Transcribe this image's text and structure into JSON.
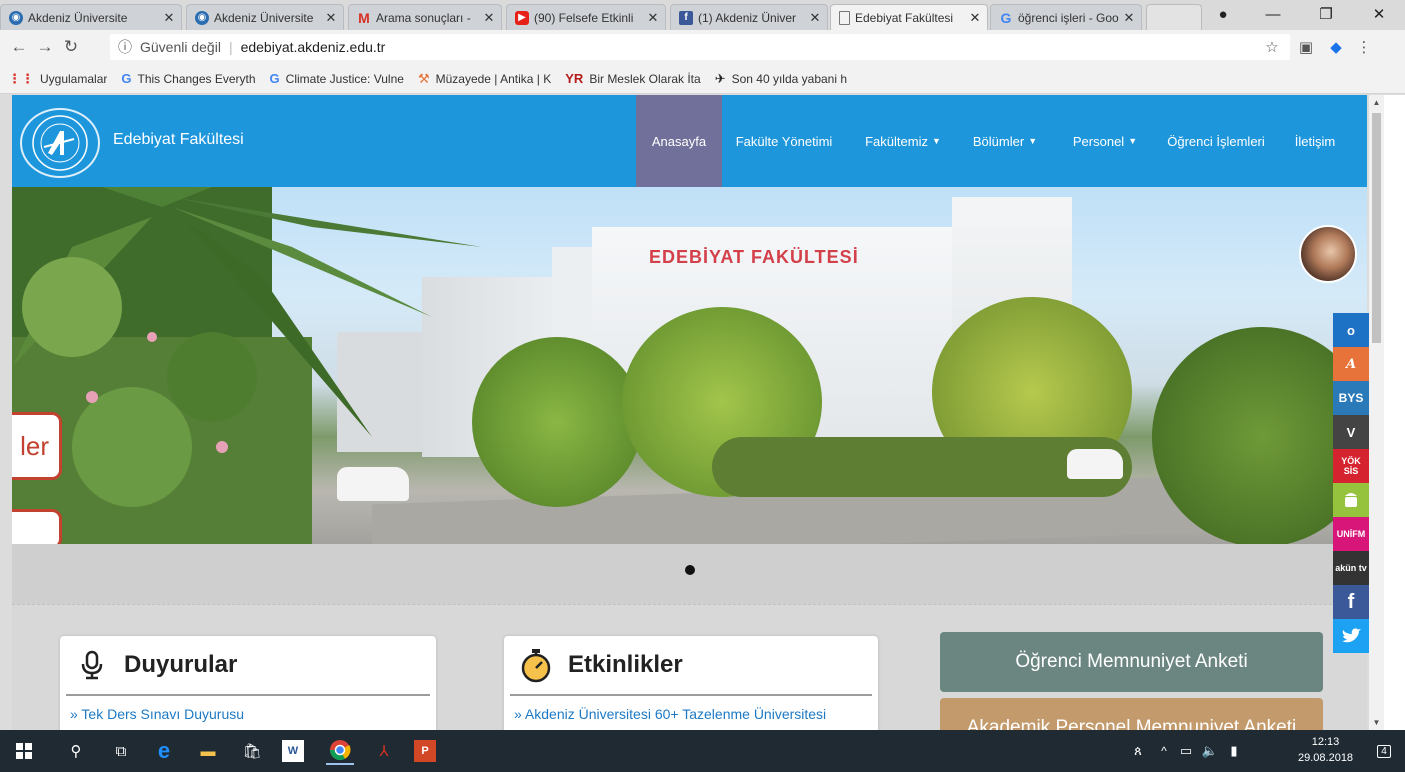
{
  "browser": {
    "tabs": [
      {
        "label": "Akdeniz Üniversite",
        "icon": "akdeniz-logo-icon",
        "color": "#2a6db0"
      },
      {
        "label": "Akdeniz Üniversite",
        "icon": "akdeniz-logo-icon",
        "color": "#2a6db0"
      },
      {
        "label": "Arama sonuçları -",
        "icon": "gmail-icon",
        "color": "#d93025"
      },
      {
        "label": "(90) Felsefe Etkinli",
        "icon": "youtube-icon",
        "color": "#e62117"
      },
      {
        "label": "(1) Akdeniz Üniver",
        "icon": "facebook-icon",
        "color": "#3b5998"
      },
      {
        "label": "Edebiyat Fakültesi",
        "icon": "page-icon",
        "color": "#777777"
      },
      {
        "label": "öğrenci işleri - Goo",
        "icon": "google-icon",
        "color": "#4285f4"
      }
    ],
    "address": {
      "security": "Güvenli değil",
      "url": "edebiyat.akdeniz.edu.tr"
    },
    "bookmarks": [
      {
        "label": "Uygulamalar",
        "icon": "apps-grid-icon"
      },
      {
        "label": "This Changes Everyth",
        "icon": "google-icon"
      },
      {
        "label": "Climate Justice: Vulne",
        "icon": "google-icon"
      },
      {
        "label": "Müzayede | Antika | K",
        "icon": "gavel-icon"
      },
      {
        "label": "Bir Meslek Olarak İta",
        "icon": "yr-icon"
      },
      {
        "label": "Son 40 yılda yabani h",
        "icon": "bird-icon"
      }
    ]
  },
  "site": {
    "name": "Edebiyat Fakültesi",
    "nav": [
      {
        "label": "Anasayfa",
        "dropdown": false
      },
      {
        "label": "Fakülte Yönetimi",
        "dropdown": false
      },
      {
        "label": "Fakültemiz",
        "dropdown": true
      },
      {
        "label": "Bölümler",
        "dropdown": true
      },
      {
        "label": "Personel",
        "dropdown": true
      },
      {
        "label": "Öğrenci İşlemleri",
        "dropdown": false
      },
      {
        "label": "İletişim",
        "dropdown": false
      }
    ],
    "hero": {
      "building_sign": "EDEBİYAT FAKÜLTESİ",
      "side_sign": "ler"
    },
    "panels": {
      "duyurular": {
        "title": "Duyurular",
        "item": "» Tek Ders Sınavı Duyurusu"
      },
      "etkinlikler": {
        "title": "Etkinlikler",
        "item": "» Akdeniz Üniversitesi 60+ Tazelenme Üniversitesi"
      }
    },
    "surveys": [
      {
        "label": "Öğrenci Memnuniyet Anketi",
        "color": "#6b8581"
      },
      {
        "label": "Akademik Personel Memnuniyet Anketi",
        "color": "#c39a6b"
      }
    ],
    "rail": [
      {
        "label": "o",
        "icon": "outlook-icon",
        "color": "#1e72c5"
      },
      {
        "label": "A",
        "icon": "signature-icon",
        "color": "#e8733a"
      },
      {
        "label": "BYS",
        "icon": "bys-icon",
        "color": "#2a79b8"
      },
      {
        "label": "V",
        "icon": "v-icon",
        "color": "#444444"
      },
      {
        "label": "YÖK SİS",
        "icon": "yoksis-icon",
        "color": "#d5232f"
      },
      {
        "label": "",
        "icon": "android-icon",
        "color": "#95c33d"
      },
      {
        "label": "UNİFM",
        "icon": "unifm-icon",
        "color": "#d8167a"
      },
      {
        "label": "akün tv",
        "icon": "akun-tv-icon",
        "color": "#333333"
      },
      {
        "label": "f",
        "icon": "facebook-icon",
        "color": "#3b5998"
      },
      {
        "label": "",
        "icon": "twitter-icon",
        "color": "#1da1f2"
      }
    ]
  },
  "taskbar": {
    "time": "12:13",
    "date": "29.08.2018",
    "notifications": "4"
  }
}
